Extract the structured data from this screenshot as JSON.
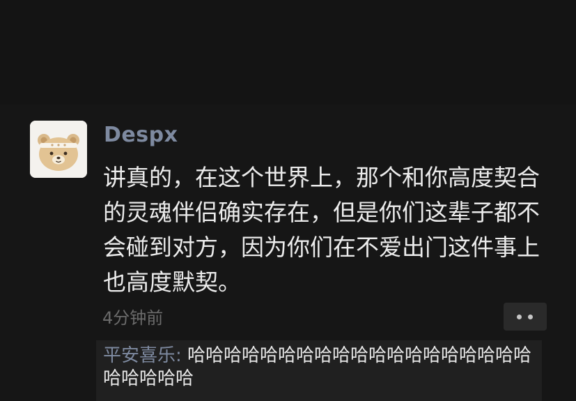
{
  "post": {
    "author": "Despx",
    "text": "讲真的，在这个世界上，那个和你高度契合的灵魂伴侣确实存在，但是你们这辈子都不会碰到对方，因为你们在不爱出门这件事上也高度默契。",
    "timestamp": "4分钟前"
  },
  "avatar_icon": "bear-avatar",
  "comments": [
    {
      "author": "平安喜乐",
      "separator": ": ",
      "text": "哈哈哈哈哈哈哈哈哈哈哈哈哈哈哈哈哈哈哈哈哈哈哈哈"
    }
  ],
  "colors": {
    "background": "#111111",
    "name": "#7e8aa0",
    "text": "#ececec",
    "timestamp": "#6b6b6b",
    "comment_bg": "#202020"
  }
}
